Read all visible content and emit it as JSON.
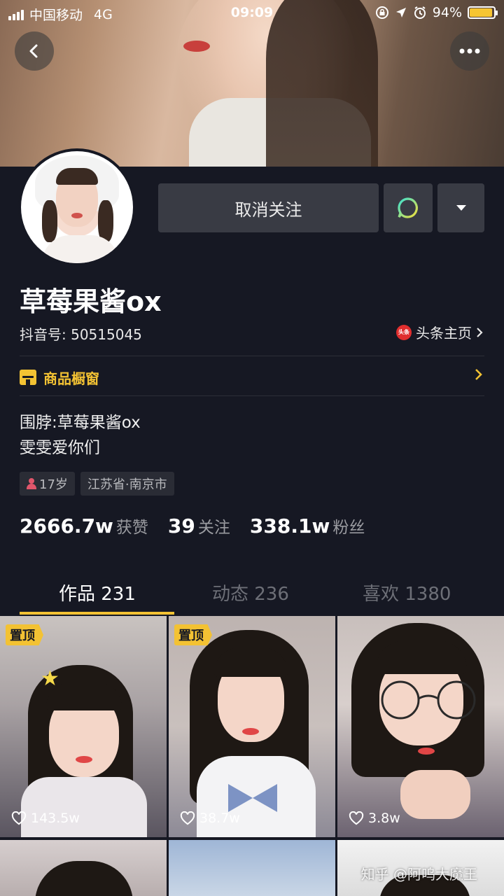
{
  "status_bar": {
    "carrier": "中国移动",
    "network": "4G",
    "time": "09:09",
    "battery": "94%",
    "battery_level": 0.94
  },
  "profile": {
    "follow_button_label": "取消关注",
    "nickname": "草莓果酱ox",
    "douyin_id": "抖音号: 50515045",
    "toutiao_logo_text": "头条",
    "toutiao_link": "头条主页",
    "shop_label": "商品橱窗",
    "bio_line1": "围脖:草莓果酱ox",
    "bio_line2": "雯雯爱你们",
    "tag_age": "17岁",
    "tag_location": "江苏省·南京市"
  },
  "stats": [
    {
      "value": "2666.7w",
      "label": "获赞"
    },
    {
      "value": "39",
      "label": "关注"
    },
    {
      "value": "338.1w",
      "label": "粉丝"
    }
  ],
  "tabs": [
    {
      "label": "作品 231",
      "active": true
    },
    {
      "label": "动态 236",
      "active": false
    },
    {
      "label": "喜欢 1380",
      "active": false
    }
  ],
  "videos": [
    {
      "pinned": "置顶",
      "likes": "143.5w"
    },
    {
      "pinned": "置顶",
      "likes": "38.7w"
    },
    {
      "pinned": "",
      "likes": "3.8w"
    }
  ],
  "watermark": "知乎 @阿呜大魔王",
  "colors": {
    "background": "#161823",
    "accent": "#f3c233",
    "button": "#393b44"
  }
}
